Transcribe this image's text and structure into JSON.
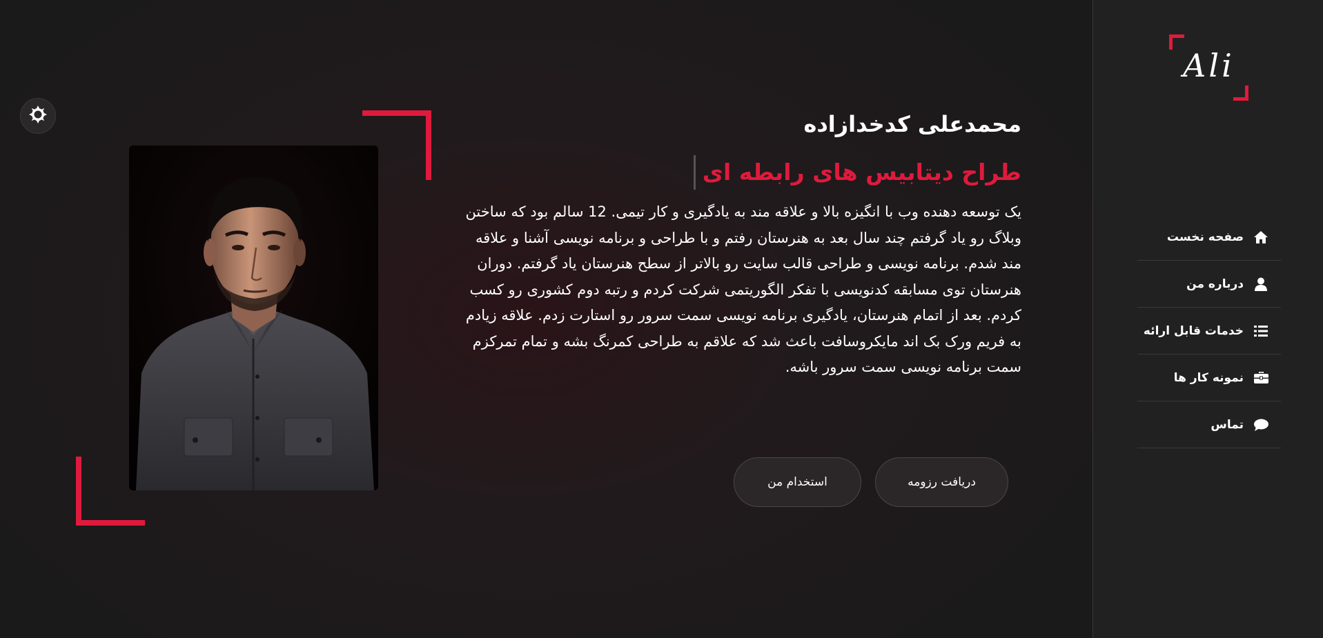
{
  "theme": {
    "accent": "#e01a3c",
    "background": "#1c1a1b",
    "sidebar_bg": "#222122",
    "text": "#ffffff"
  },
  "logo": {
    "text": "Ali"
  },
  "nav": {
    "items": [
      {
        "label": "صفحه نخست",
        "icon": "home-icon"
      },
      {
        "label": "درباره من",
        "icon": "user-icon"
      },
      {
        "label": "خدمات قابل ارائه",
        "icon": "list-icon"
      },
      {
        "label": "نمونه کار ها",
        "icon": "briefcase-icon"
      },
      {
        "label": "تماس",
        "icon": "chat-bubble-icon"
      }
    ]
  },
  "theme_toggle": {
    "icon": "sun-icon"
  },
  "intro": {
    "name": "محمدعلی کدخدازاده",
    "role": "طراح دیتابیس های رابطه ای",
    "bio": "یک توسعه دهنده وب با انگیزه بالا و علاقه مند به یادگیری و کار تیمی. 12 سالم بود که ساختن وبلاگ رو یاد گرفتم چند سال بعد به هنرستان رفتم و با طراحی و برنامه نویسی آشنا و علاقه مند شدم. برنامه نویسی و طراحی قالب سایت رو بالاتر از سطح هنرستان یاد گرفتم. دوران هنرستان توی مسابقه کدنویسی با تفکر الگوریتمی شرکت کردم و رتبه دوم کشوری رو کسب کردم. بعد از اتمام هنرستان، یادگیری برنامه نویسی سمت سرور رو استارت زدم. علاقه زیادم به فریم ورک بک اند مایکروسافت باعث شد که علاقم به طراحی کمرنگ بشه و تمام تمرکزم سمت برنامه نویسی سمت سرور باشه."
  },
  "buttons": {
    "hire_label": "استخدام من",
    "cv_label": "دریافت رزومه"
  }
}
